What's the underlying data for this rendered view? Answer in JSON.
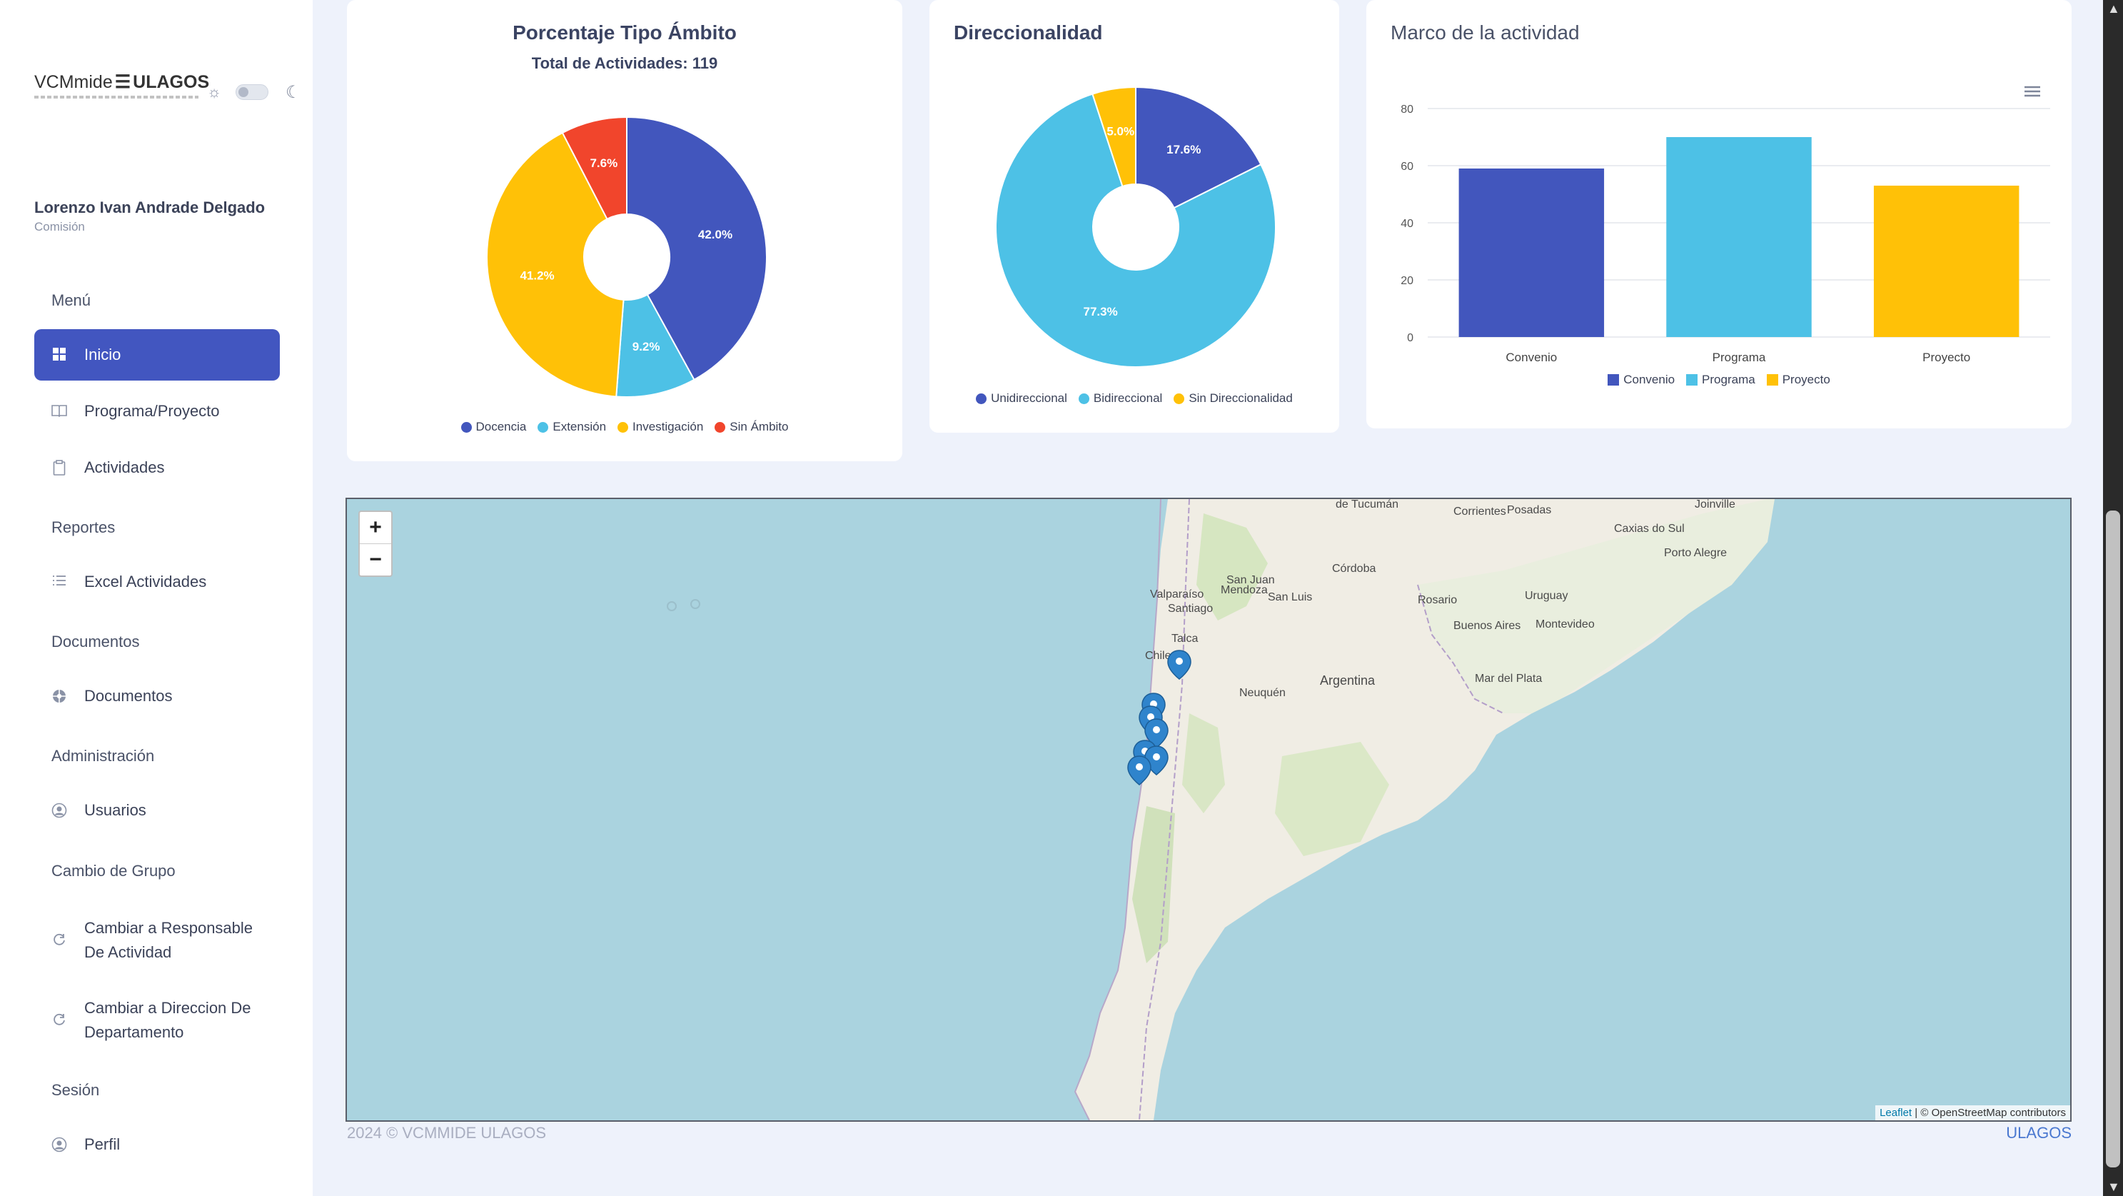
{
  "app": {
    "logo_text_a": "VCMmide",
    "logo_text_b": "ULAGOS"
  },
  "theme": {
    "sun_icon": "sun-icon",
    "moon_icon": "moon-icon",
    "dark_mode": false
  },
  "user": {
    "name": "Lorenzo Ivan Andrade Delgado",
    "role": "Comisión"
  },
  "sidebar": {
    "sections": [
      {
        "title": "Menú",
        "items": [
          {
            "label": "Inicio",
            "icon": "grid-icon",
            "active": true
          },
          {
            "label": "Programa/Proyecto",
            "icon": "book-icon",
            "active": false
          },
          {
            "label": "Actividades",
            "icon": "clipboard-icon",
            "active": false
          }
        ]
      },
      {
        "title": "Reportes",
        "items": [
          {
            "label": "Excel Actividades",
            "icon": "list-icon",
            "active": false
          }
        ]
      },
      {
        "title": "Documentos",
        "items": [
          {
            "label": "Documentos",
            "icon": "globe-icon",
            "active": false
          }
        ]
      },
      {
        "title": "Administración",
        "items": [
          {
            "label": "Usuarios",
            "icon": "user-circle-icon",
            "active": false
          }
        ]
      },
      {
        "title": "Cambio de Grupo",
        "items": [
          {
            "label": "Cambiar a Responsable De Actividad",
            "label_line1": "Cambiar a Responsable",
            "label_line2": "De Actividad",
            "icon": "refresh-icon",
            "active": false
          },
          {
            "label": "Cambiar a Direccion De Departamento",
            "label_line1": "Cambiar a Direccion De",
            "label_line2": "Departamento",
            "icon": "refresh-icon",
            "active": false
          }
        ]
      },
      {
        "title": "Sesión",
        "items": [
          {
            "label": "Perfil",
            "icon": "user-circle-icon",
            "active": false
          }
        ]
      }
    ]
  },
  "chart_data": [
    {
      "type": "pie",
      "title": "Porcentaje Tipo Ámbito",
      "subtitle": "Total de Actividades: 119",
      "labels": [
        "Docencia",
        "Extensión",
        "Investigación",
        "Sin Ámbito"
      ],
      "values": [
        42.0,
        9.2,
        41.2,
        7.6
      ],
      "value_labels": [
        "42.0%",
        "9.2%",
        "41.2%",
        "7.6%"
      ],
      "colors": [
        "#4256bd",
        "#4dc1e6",
        "#ffc107",
        "#f1452c"
      ],
      "legend": "bottom"
    },
    {
      "type": "pie",
      "title": "Direccionalidad",
      "labels": [
        "Unidireccional",
        "Bidireccional",
        "Sin Direccionalidad"
      ],
      "values": [
        17.6,
        77.3,
        5.0
      ],
      "value_labels": [
        "17.6%",
        "77.3%",
        "5.0%"
      ],
      "colors": [
        "#4256bd",
        "#4dc1e6",
        "#ffc107"
      ],
      "legend": "bottom"
    },
    {
      "type": "bar",
      "title": "Marco de la actividad",
      "categories": [
        "Convenio",
        "Programa",
        "Proyecto"
      ],
      "values": [
        59,
        70,
        53
      ],
      "colors": [
        "#4256bd",
        "#4dc1e6",
        "#ffc107"
      ],
      "ylim": [
        0,
        80
      ],
      "yticks": [
        0,
        20,
        40,
        60,
        80
      ],
      "grid": true,
      "legend": "bottom"
    }
  ],
  "map": {
    "zoom_in": "+",
    "zoom_out": "−",
    "attribution_leaflet": "Leaflet",
    "attribution_osm": "| © OpenStreetMap contributors",
    "labels": [
      "de Tucumán",
      "Corrientes",
      "Posadas",
      "Joinville",
      "Caxias do Sul",
      "Porto Alegre",
      "Córdoba",
      "San Juan",
      "Mendoza",
      "San Luis",
      "Rosario",
      "Uruguay",
      "Santiago",
      "Buenos Aires",
      "Montevideo",
      "Talca",
      "Chile",
      "Argentina",
      "Mar del Plata",
      "Neuquén",
      "Valparaíso"
    ]
  },
  "footer": {
    "left": "2024 © VCMMIDE ULAGOS",
    "right": "ULAGOS"
  }
}
